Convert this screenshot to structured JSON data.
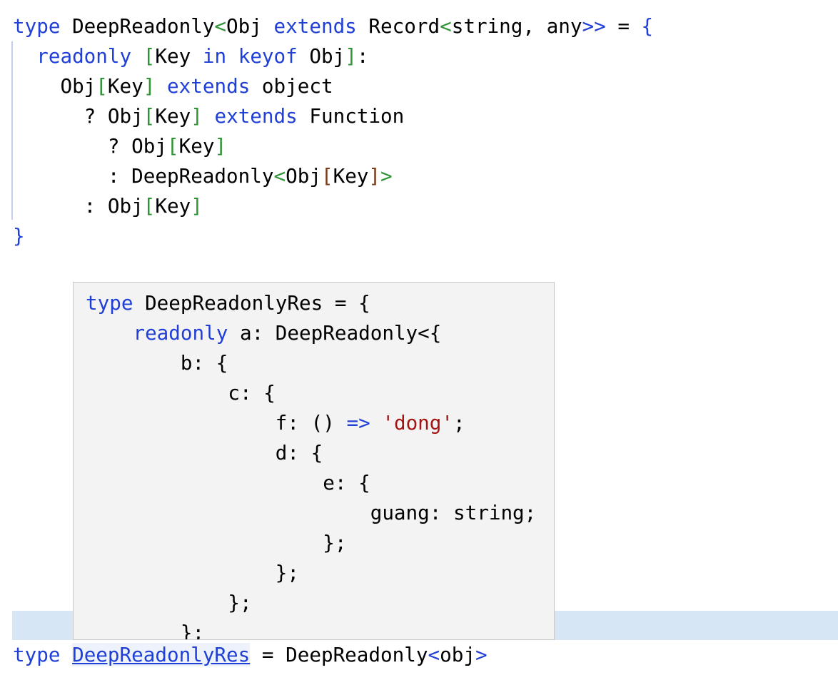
{
  "editor": {
    "lines": [
      [
        [
          "type",
          "kw"
        ],
        [
          " DeepReadonly",
          ""
        ],
        [
          "<",
          "br"
        ],
        [
          "Obj ",
          ""
        ],
        [
          "extends",
          "kw"
        ],
        [
          " Record",
          ""
        ],
        [
          "<",
          "br"
        ],
        [
          "string, any",
          ""
        ],
        [
          ">>",
          "kw"
        ],
        [
          " = ",
          ""
        ],
        [
          "{",
          "kw"
        ]
      ],
      [
        [
          "  ",
          ""
        ],
        [
          "readonly",
          "kw"
        ],
        [
          " ",
          ""
        ],
        [
          "[",
          "br"
        ],
        [
          "Key ",
          ""
        ],
        [
          "in",
          "kw"
        ],
        [
          " ",
          ""
        ],
        [
          "keyof",
          "kw"
        ],
        [
          " Obj",
          ""
        ],
        [
          "]",
          "br"
        ],
        [
          ":",
          ""
        ]
      ],
      [
        [
          "    Obj",
          ""
        ],
        [
          "[",
          "br"
        ],
        [
          "Key",
          ""
        ],
        [
          "]",
          "br"
        ],
        [
          " ",
          ""
        ],
        [
          "extends",
          "kw"
        ],
        [
          " object",
          ""
        ]
      ],
      [
        [
          "      ? Obj",
          ""
        ],
        [
          "[",
          "br"
        ],
        [
          "Key",
          ""
        ],
        [
          "]",
          "br"
        ],
        [
          " ",
          ""
        ],
        [
          "extends",
          "kw"
        ],
        [
          " Function",
          ""
        ]
      ],
      [
        [
          "        ? Obj",
          ""
        ],
        [
          "[",
          "br"
        ],
        [
          "Key",
          ""
        ],
        [
          "]",
          "br"
        ]
      ],
      [
        [
          "        : DeepReadonly",
          ""
        ],
        [
          "<",
          "br"
        ],
        [
          "Obj",
          ""
        ],
        [
          "[",
          "br2"
        ],
        [
          "Key",
          ""
        ],
        [
          "]",
          "br2"
        ],
        [
          ">",
          "br"
        ]
      ],
      [
        [
          "      : Obj",
          ""
        ],
        [
          "[",
          "br"
        ],
        [
          "Key",
          ""
        ],
        [
          "]",
          "br"
        ]
      ],
      [
        [
          "}",
          "kw"
        ]
      ]
    ],
    "last_line": [
      [
        "type",
        "kw"
      ],
      [
        " ",
        ""
      ],
      [
        "DeepReadonlyRes",
        "link"
      ],
      [
        " = DeepReadonly",
        ""
      ],
      [
        "<",
        "kw"
      ],
      [
        "obj",
        ""
      ],
      [
        ">",
        "kw"
      ]
    ]
  },
  "hover_tooltip": {
    "lines": [
      [
        [
          "type",
          "kw"
        ],
        [
          " DeepReadonlyRes = {",
          ""
        ]
      ],
      [
        [
          "    ",
          ""
        ],
        [
          "readonly",
          "kw"
        ],
        [
          " a: DeepReadonly<{",
          ""
        ]
      ],
      [
        [
          "        b: {",
          ""
        ]
      ],
      [
        [
          "            c: {",
          ""
        ]
      ],
      [
        [
          "                f: () ",
          ""
        ],
        [
          "=>",
          "kw"
        ],
        [
          " ",
          ""
        ],
        [
          "'dong'",
          "str"
        ],
        [
          ";",
          ""
        ]
      ],
      [
        [
          "                d: {",
          ""
        ]
      ],
      [
        [
          "                    e: {",
          ""
        ]
      ],
      [
        [
          "                        guang: string;",
          ""
        ]
      ],
      [
        [
          "                    };",
          ""
        ]
      ],
      [
        [
          "                };",
          ""
        ]
      ],
      [
        [
          "            };",
          ""
        ]
      ],
      [
        [
          "        };",
          ""
        ]
      ]
    ]
  }
}
